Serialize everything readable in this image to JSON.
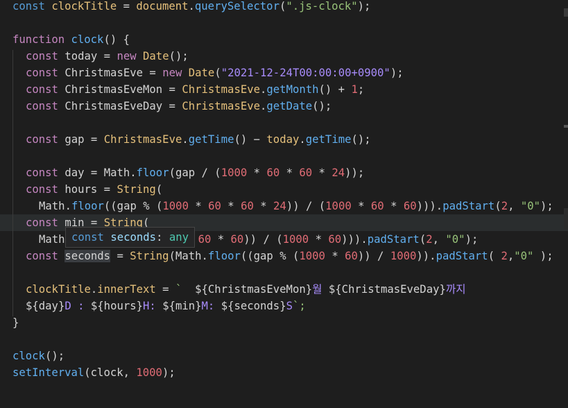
{
  "code": {
    "l1": {
      "kw": "const",
      "name": "clockTitle",
      "eq": " = ",
      "obj": "document",
      "dot": ".",
      "fn": "querySelector",
      "open": "(",
      "str": "\".js-clock\"",
      "close": ");"
    },
    "l2": {
      "kw": "function",
      "name": "clock",
      "rest": "() {"
    },
    "l3": {
      "kw": "const",
      "name": "today",
      "eq": " = ",
      "new": "new",
      "cls": "Date",
      "rest": "();"
    },
    "l4": {
      "kw": "const",
      "name": "ChristmasEve",
      "eq": " = ",
      "new": "new",
      "cls": "Date",
      "open": "(",
      "str": "\"2021-12-24T00:00:00+0900\"",
      "close": ");"
    },
    "l5": {
      "kw": "const",
      "name": "ChristmasEveMon",
      "eq": " = ",
      "obj": "ChristmasEve",
      "dot": ".",
      "fn": "getMonth",
      "mid": "() + ",
      "num": "1",
      "close": ";"
    },
    "l6": {
      "kw": "const",
      "name": "ChristmasEveDay",
      "eq": " = ",
      "obj": "ChristmasEve",
      "dot": ".",
      "fn": "getDate",
      "close": "();"
    },
    "l7": {
      "kw": "const",
      "name": "gap",
      "eq": " = ",
      "obj": "ChristmasEve",
      "dot": ".",
      "fn": "getTime",
      "mid": "() − ",
      "obj2": "today",
      "dot2": ".",
      "fn2": "getTime",
      "close": "();"
    },
    "l8": {
      "kw": "const",
      "name": "day",
      "eq": " = ",
      "cls": "Math",
      "dot": ".",
      "fn": "floor",
      "a": "(gap / (",
      "n1": "1000",
      "m1": " * ",
      "n2": "60",
      "m2": " * ",
      "n3": "60",
      "m3": " * ",
      "n4": "24",
      "close": "));"
    },
    "l9": {
      "kw": "const",
      "name": "hours",
      "eq": " = ",
      "cls": "String",
      "close": "("
    },
    "l10": {
      "cls": "Math",
      "dot": ".",
      "fn": "floor",
      "a": "((gap % (",
      "n1": "1000",
      "m1": " * ",
      "n2": "60",
      "m2": " * ",
      "n3": "60",
      "m3": " * ",
      "n4": "24",
      "b": ")) / (",
      "n5": "1000",
      "m4": " * ",
      "n6": "60",
      "m5": " * ",
      "n7": "60",
      "c": "))).",
      "fn2": "padStart",
      "d": "(",
      "n8": "2",
      "e": ", ",
      "str": "\"0\"",
      "close": ");"
    },
    "l11": {
      "kw": "const",
      "name": "min",
      "eq": " = ",
      "cls": "String",
      "close": "("
    },
    "l12": {
      "cls": "Math",
      "hidden": "",
      "n1": "60",
      "m1": " * ",
      "n2": "60",
      "a": ")) / (",
      "n3": "1000",
      "m2": " * ",
      "n4": "60",
      "b": "))).",
      "fn": "padStart",
      "c": "(",
      "n5": "2",
      "d": ", ",
      "str": "\"0\"",
      "close": ");"
    },
    "l13": {
      "kw": "const",
      "name": "seconds",
      "eq": " = ",
      "cls": "String",
      "a": "(",
      "cls2": "Math",
      "dot": ".",
      "fn": "floor",
      "b": "((gap % (",
      "n1": "1000",
      "m1": " * ",
      "n2": "60",
      "c": ")) / ",
      "n3": "1000",
      "d": ")).",
      "fn2": "padStart",
      "e": "( ",
      "n4": "2",
      "f": ",",
      "str": "\"0\"",
      "close": " );"
    },
    "l14": {
      "obj": "clockTitle",
      "dot": ".",
      "prop": "innerText",
      "eq": " = ",
      "tick": "`  ",
      "e1": "${ChristmasEveMon}",
      "t1": "월 ",
      "e2": "${ChristmasEveDay}",
      "t2": "까지"
    },
    "l15": {
      "e1": "${day}",
      "t1": "D : ",
      "e2": "${hours}",
      "t2": "H: ",
      "e3": "${min}",
      "t3": "M: ",
      "e4": "${seconds}",
      "t4": "S",
      "close": "`;"
    },
    "l16": {
      "close": "}"
    },
    "l17": {
      "fn": "clock",
      "close": "();"
    },
    "l18": {
      "fn": "setInterval",
      "a": "(clock, ",
      "num": "1000",
      "close": ");"
    }
  },
  "tooltip": {
    "kw": "const",
    "name": "seconds",
    "colon": ": ",
    "type": "any"
  }
}
